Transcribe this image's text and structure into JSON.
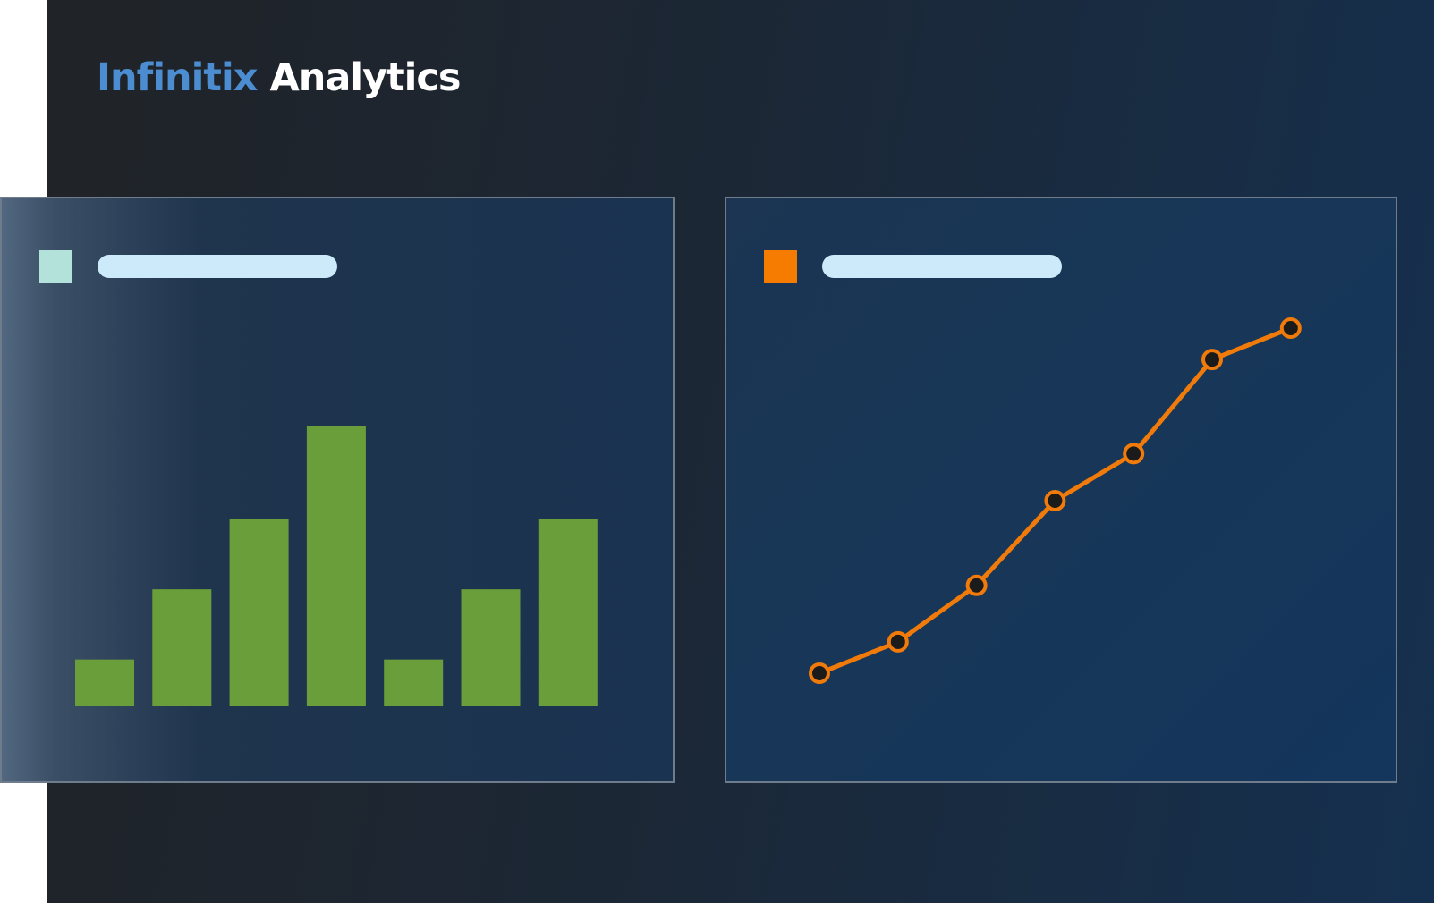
{
  "brand": {
    "name_part1": "Infinitix",
    "name_part2": "Analytics"
  },
  "colors": {
    "brand_accent": "#4b8dd0",
    "bar_fill": "#6a9e3a",
    "line_stroke": "#f07a0a",
    "marker_fill": "#1b1b1b",
    "legend_teal": "#b3e2da",
    "legend_orange": "#f57c00",
    "title_placeholder": "#cdeafb"
  },
  "chart_data": [
    {
      "type": "bar",
      "categories": [
        "",
        "",
        "",
        "",
        "",
        "",
        ""
      ],
      "values": [
        1,
        2.5,
        4,
        6,
        1,
        2.5,
        4
      ],
      "ylim": [
        0,
        6
      ],
      "grid": false,
      "legend": "top-left",
      "title": "",
      "xlabel": "",
      "ylabel": ""
    },
    {
      "type": "line",
      "x": [
        1,
        2,
        3,
        4,
        5,
        6,
        7
      ],
      "values": [
        1,
        1.5,
        2.4,
        3.75,
        4.5,
        6,
        6.5
      ],
      "ylim": [
        0.5,
        7
      ],
      "grid": false,
      "markers": true,
      "legend": "top-left",
      "title": "",
      "xlabel": "",
      "ylabel": ""
    }
  ]
}
